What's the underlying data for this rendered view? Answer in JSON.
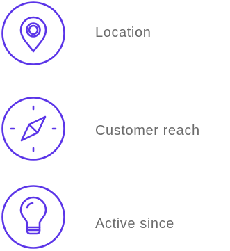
{
  "theme": {
    "accent": "#5b35e8",
    "label_color": "#6b6b6b"
  },
  "features": [
    {
      "icon": "location-pin-icon",
      "label": "Location"
    },
    {
      "icon": "compass-icon",
      "label": "Customer reach"
    },
    {
      "icon": "lightbulb-icon",
      "label": "Active since"
    }
  ]
}
